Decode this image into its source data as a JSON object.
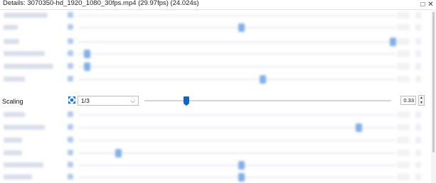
{
  "window": {
    "title": "Details: 3070350-hd_1920_1080_30fps.mp4 (29.97fps) (24.024s)",
    "restore_glyph": "□",
    "close_glyph": "✕"
  },
  "scaling": {
    "label": "Scaling",
    "icon": "scale-arrows-icon",
    "combo_value": "1/3",
    "slider_fraction": 0.17,
    "value": "0.33",
    "up_glyph": "▲",
    "down_glyph": "▼"
  },
  "colors": {
    "accent": "#1565c0",
    "track": "#d3d7dd"
  }
}
